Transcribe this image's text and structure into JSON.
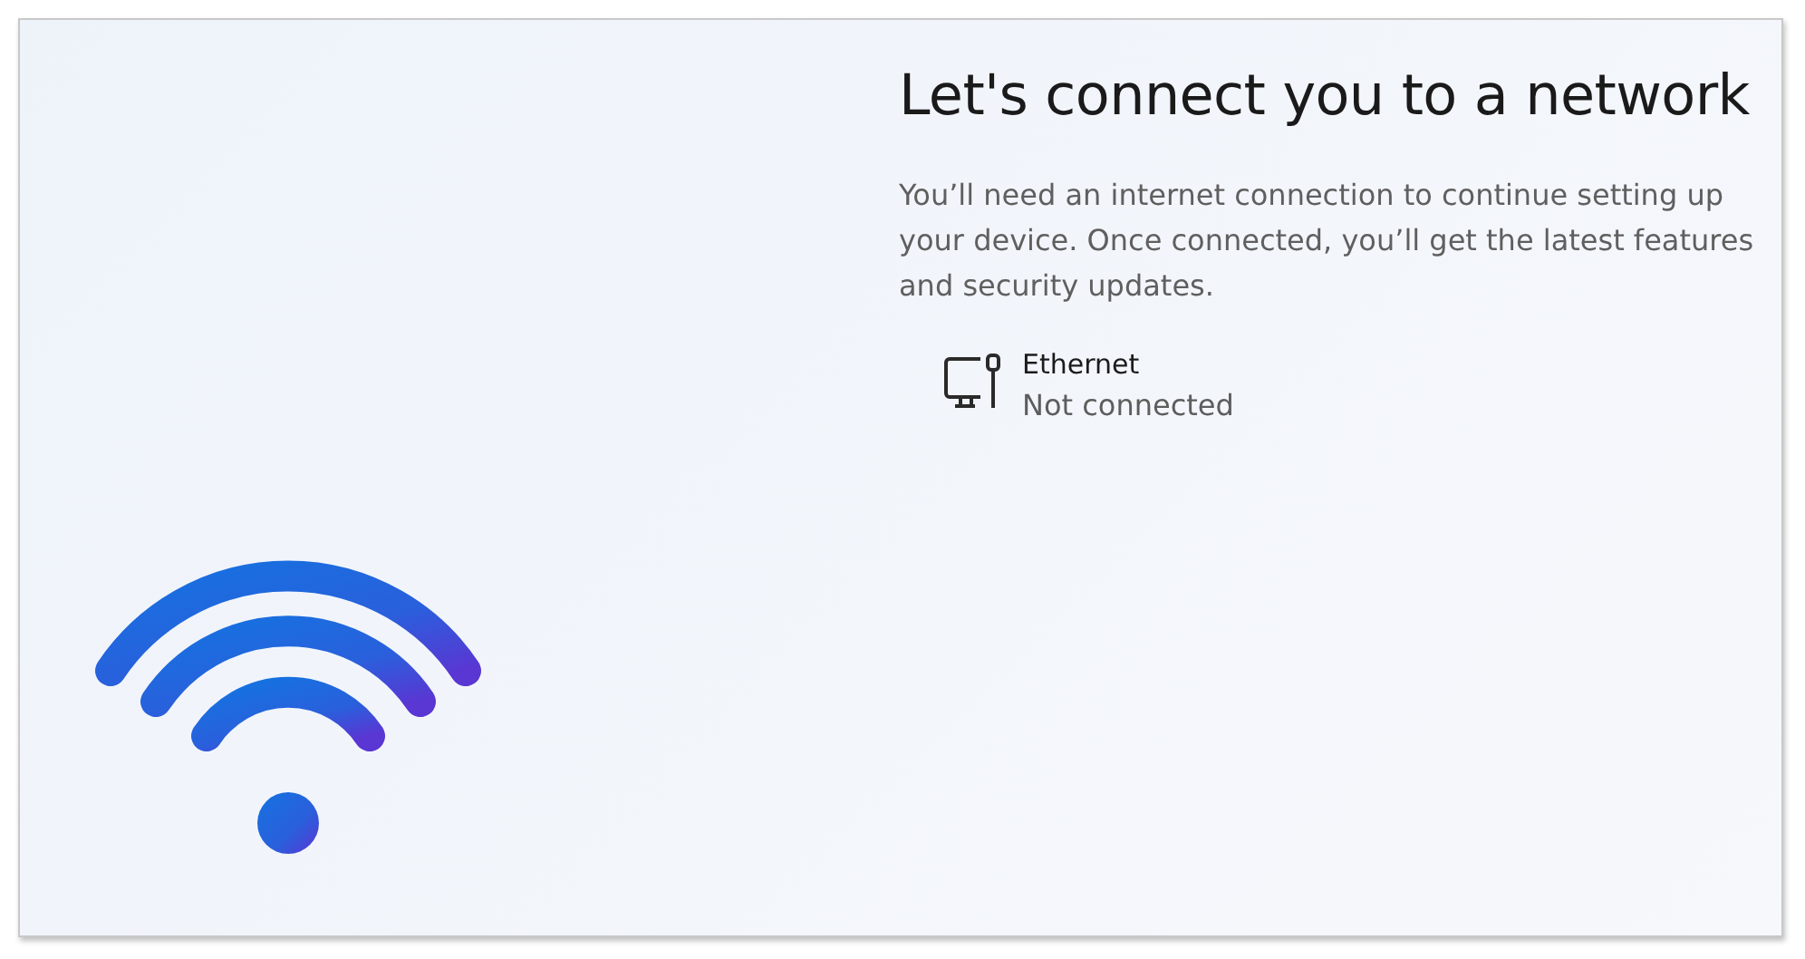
{
  "heading": "Let's connect you to a network",
  "description": "You’ll need an internet connection to continue setting up your device. Once connected, you’ll get the latest features and security updates.",
  "networks": [
    {
      "name": "Ethernet",
      "status": "Not connected"
    }
  ]
}
